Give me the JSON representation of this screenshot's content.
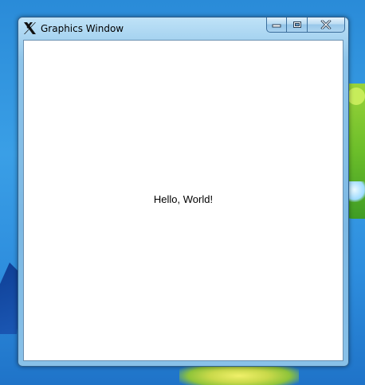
{
  "window": {
    "title": "Graphics Window",
    "app_icon": "x-logo-icon"
  },
  "caption_buttons": {
    "minimize_icon": "minimize-icon",
    "maximize_icon": "maximize-icon",
    "close_icon": "close-icon"
  },
  "content": {
    "text": "Hello, World!"
  },
  "colors": {
    "desktop": "#2e8ede",
    "titlebar": "#8fc5ea",
    "client_background": "#ffffff",
    "text": "#000000"
  }
}
